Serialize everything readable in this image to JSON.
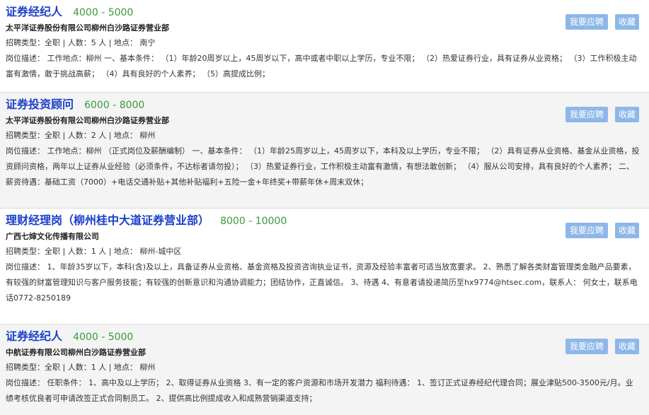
{
  "jobs": [
    {
      "title": "证券经纪人",
      "salary": "4000 - 5000",
      "company": "太平洋证券股份有限公司柳州白沙路证券营业部",
      "meta": "招聘类型：全职 | 人数：5 人 | 地点：  南宁",
      "description": "岗位描述：  工作地点：柳州 一、基本条件：  （1）年龄20周岁以上，45周岁以下，高中或者中职以上学历，专业不限；  （2）热爱证券行业，具有证券从业资格；  （3）工作积极主动富有激情，敢于挑战高薪；  （4）具有良好的个人素养；  （5）高提成比例；",
      "apply_label": "我要应聘",
      "fav_label": "收藏"
    },
    {
      "title": "证券投资顾问",
      "salary": "6000 - 8000",
      "company": "太平洋证券股份有限公司柳州白沙路证券营业部",
      "meta": "招聘类型：全职 | 人数：2 人 | 地点：  柳州",
      "description": "岗位描述：  工作地点：柳州  （正式岗位及薪酬编制） 一、基本条件：  （1）年龄25周岁以上，45周岁以下，本科及以上学历，专业不限；  （2）具有证券从业资格、基金从业资格，投资顾问资格，两年以上证券从业经验（必须条件，不达标者请勿投）；  （3）热爱证券行业，工作积极主动富有激情，有想法敢创新；  （4）服从公司安排，具有良好的个人素养；  二、薪资待遇：基础工资（7000）+电话交通补贴+其他补贴福利+五险一金+年终奖+带薪年休+周末双休；",
      "apply_label": "我要应聘",
      "fav_label": "收藏"
    },
    {
      "title": "理财经理岗（柳州桂中大道证券营业部）",
      "salary": "8000 - 10000",
      "company": "广西七婶文化传播有限公司",
      "meta": "招聘类型：全职 | 人数：1 人 | 地点：  柳州-城中区",
      "description": "岗位描述：  1、年龄35岁以下，本科(含)及以上，具备证券从业资格、基金资格及投资咨询执业证书，资源及经验丰富者可适当放宽要求。  2、熟悉了解各类财富管理类金融产品要素，有较强的财富管理知识与客户服务技能；有较强的创新意识和沟通协调能力；团结协作，正直诚信。  3、待遇 4、有意者请投递简历至hx9774@htsec.com，联系人：  何女士，联系电话0772-8250189",
      "apply_label": "我要应聘",
      "fav_label": "收藏"
    },
    {
      "title": "证券经纪人",
      "salary": "4000 - 5000",
      "company": "中航证券有限公司柳州白沙路证券营业部",
      "meta": "招聘类型：全职 | 人数：1 人 | 地点：  柳州",
      "description": "岗位描述：  任职条件：  1、高中及以上学历；  2、取得证券从业资格 3、有一定的客户资源和市场开发潜力  福利待遇：  1、签订正式证券经纪代理合同；展业津贴500-3500元/月。业绩考核优良者可申请改签正式合同制员工。  2、提供高比例提成收入和成熟营销渠道支持；",
      "apply_label": "我要应聘",
      "fav_label": "收藏"
    }
  ]
}
